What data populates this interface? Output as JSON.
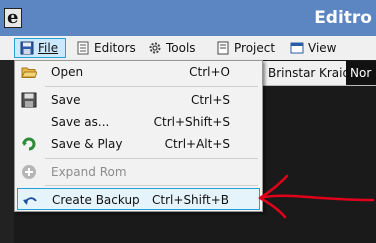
{
  "window": {
    "title": "Editro"
  },
  "menubar": {
    "items": [
      {
        "label": "File",
        "icon": "floppy-disk-icon",
        "active": true
      },
      {
        "label": "Editors",
        "icon": "editors-icon"
      },
      {
        "label": "Tools",
        "icon": "gear-icon"
      },
      {
        "label": "Project",
        "icon": "project-icon"
      },
      {
        "label": "View",
        "icon": "window-icon"
      }
    ]
  },
  "toolbar_strip": {
    "items": [
      "Brinstar",
      "Kraid",
      "Nor"
    ]
  },
  "file_menu": {
    "items": [
      {
        "label": "Open",
        "shortcut": "Ctrl+O",
        "icon": "open-folder-icon",
        "enabled": true
      },
      {
        "label": "Save",
        "shortcut": "Ctrl+S",
        "icon": "save-icon",
        "enabled": true
      },
      {
        "label": "Save as...",
        "shortcut": "Ctrl+Shift+S",
        "icon": "",
        "enabled": true
      },
      {
        "label": "Save & Play",
        "shortcut": "Ctrl+Alt+S",
        "icon": "save-play-icon",
        "enabled": true
      },
      {
        "label": "Expand Rom",
        "shortcut": "",
        "icon": "plus-circle-icon",
        "enabled": false
      },
      {
        "label": "Create Backup",
        "shortcut": "Ctrl+Shift+B",
        "icon": "undo-arrow-icon",
        "enabled": true,
        "highlighted": true
      }
    ]
  },
  "colors": {
    "titlebar": "#5b86c2",
    "menu_bg": "#f2f2f2",
    "highlight_border": "#26a0da",
    "annotation": "#e0001a"
  }
}
